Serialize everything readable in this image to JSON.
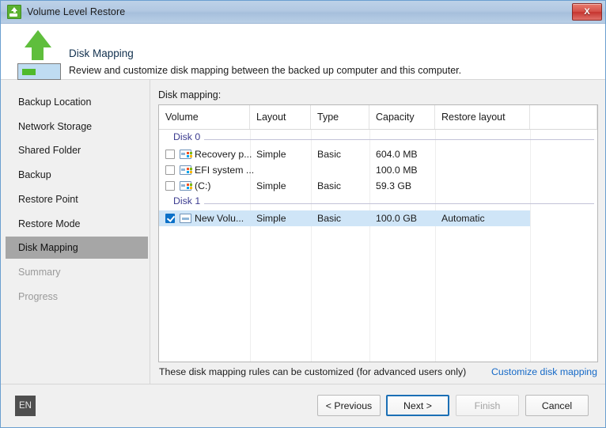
{
  "window": {
    "title": "Volume Level Restore",
    "app_icon": "green-restore-drive-icon",
    "close_label": "X"
  },
  "header": {
    "icon": "green-up-arrow-drive-icon",
    "title": "Disk Mapping",
    "subtitle": "Review and customize disk mapping between the backed up computer and this computer."
  },
  "sidebar": {
    "items": [
      {
        "label": "Backup Location",
        "state": "normal"
      },
      {
        "label": "Network Storage",
        "state": "normal"
      },
      {
        "label": "Shared Folder",
        "state": "normal"
      },
      {
        "label": "Backup",
        "state": "normal"
      },
      {
        "label": "Restore Point",
        "state": "normal"
      },
      {
        "label": "Restore Mode",
        "state": "normal"
      },
      {
        "label": "Disk Mapping",
        "state": "selected"
      },
      {
        "label": "Summary",
        "state": "disabled"
      },
      {
        "label": "Progress",
        "state": "disabled"
      }
    ]
  },
  "main": {
    "section_label": "Disk mapping:",
    "columns": [
      "Volume",
      "Layout",
      "Type",
      "Capacity",
      "Restore layout",
      ""
    ],
    "rows": [
      {
        "kind": "group",
        "label": "Disk 0"
      },
      {
        "kind": "volume",
        "checked": false,
        "icon": "windows-drive-icon",
        "volume": "Recovery p...",
        "layout": "Simple",
        "type": "Basic",
        "capacity": "604.0 MB",
        "restore_layout": ""
      },
      {
        "kind": "volume",
        "checked": false,
        "icon": "windows-drive-icon",
        "volume": "EFI system ...",
        "layout": "",
        "type": "",
        "capacity": "100.0 MB",
        "restore_layout": ""
      },
      {
        "kind": "volume",
        "checked": false,
        "icon": "windows-drive-icon",
        "volume": "(C:)",
        "layout": "Simple",
        "type": "Basic",
        "capacity": "59.3 GB",
        "restore_layout": ""
      },
      {
        "kind": "group",
        "label": "Disk 1"
      },
      {
        "kind": "volume",
        "checked": true,
        "selected": true,
        "icon": "plain-drive-icon",
        "volume": "New Volu...",
        "layout": "Simple",
        "type": "Basic",
        "capacity": "100.0 GB",
        "restore_layout": "Automatic"
      }
    ],
    "note": "These disk mapping rules can be customized (for advanced users only)",
    "customize_link": "Customize disk mapping"
  },
  "bottom": {
    "language": "EN",
    "buttons": [
      {
        "label": "< Previous",
        "state": "normal"
      },
      {
        "label": "Next >",
        "state": "primary"
      },
      {
        "label": "Finish",
        "state": "disabled"
      },
      {
        "label": "Cancel",
        "state": "normal"
      }
    ]
  },
  "colors": {
    "accent": "#1569c7",
    "primary_border": "#1b6fb5",
    "selection": "#cfe5f7",
    "nav_selected": "#a6a6a6",
    "group_text": "#3b3b8f",
    "icon_green": "#5fbe3c",
    "close_red": "#c5342f"
  }
}
